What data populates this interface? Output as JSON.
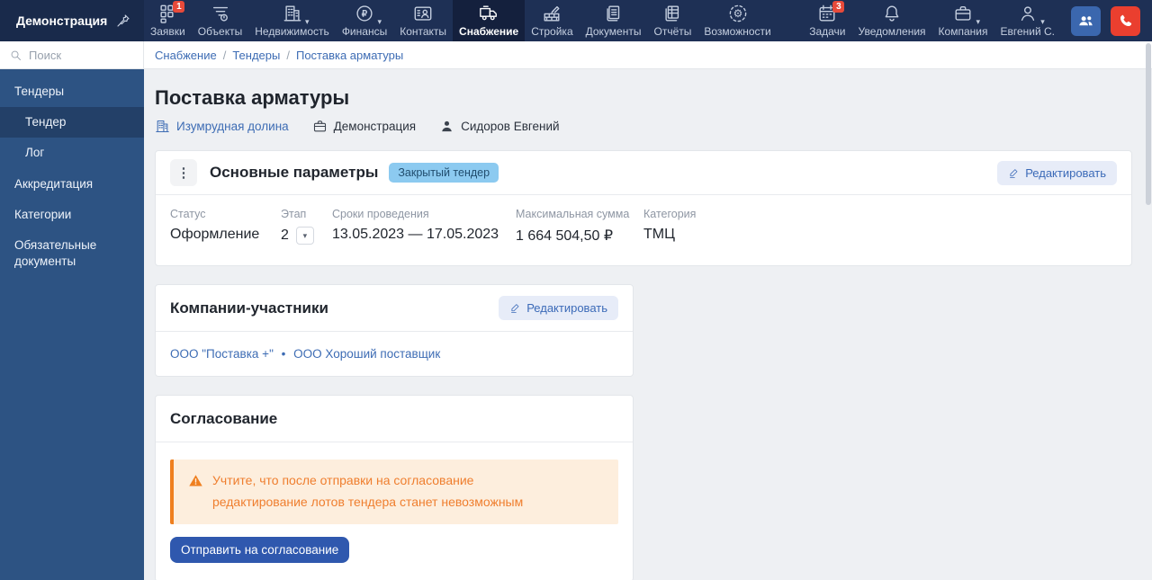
{
  "colors": {
    "topbar_bg": "#1e3055",
    "topbar_left_bg": "#192a4b",
    "topbar_active_bg": "#14203d",
    "badge_red": "#e84a3a",
    "sidebar_bg": "#2d5383",
    "sidebar_active_bg": "#234068",
    "link_blue": "#3d6cb4",
    "tag_blue_bg": "#8ccaf0",
    "tag_blue_text": "#214d6e",
    "edit_btn_bg": "#e7ecf8",
    "edit_btn_text": "#3b6ab8",
    "warning_bg": "#fdeedd",
    "warning_accent": "#ef7f1f",
    "warning_text": "#ef7e2e",
    "primary_btn_bg": "#2f58ae",
    "people_btn_blue": "#3b67ae",
    "call_btn_red": "#ea3f2f"
  },
  "topbar": {
    "workspace": "Демонстрация",
    "items": [
      {
        "label": "Заявки",
        "badge": "1"
      },
      {
        "label": "Объекты"
      },
      {
        "label": "Недвижимость"
      },
      {
        "label": "Финансы"
      },
      {
        "label": "Контакты"
      },
      {
        "label": "Снабжение"
      },
      {
        "label": "Стройка"
      },
      {
        "label": "Документы"
      },
      {
        "label": "Отчёты"
      },
      {
        "label": "Возможности"
      }
    ],
    "right_items": [
      {
        "label": "Задачи",
        "badge": "3"
      },
      {
        "label": "Уведомления"
      },
      {
        "label": "Компания"
      },
      {
        "label": "Евгений С."
      }
    ]
  },
  "sidebar": {
    "search_placeholder": "Поиск",
    "items": [
      {
        "label": "Тендеры"
      },
      {
        "label": "Тендер"
      },
      {
        "label": "Лог"
      },
      {
        "label": "Аккредитация"
      },
      {
        "label": "Категории"
      },
      {
        "label": "Обязательные документы"
      }
    ]
  },
  "breadcrumb": {
    "separator": "/",
    "items": [
      "Снабжение",
      "Тендеры",
      "Поставка арматуры"
    ]
  },
  "page": {
    "title": "Поставка арматуры",
    "meta": {
      "project": "Изумрудная долина",
      "company": "Демонстрация",
      "owner": "Сидоров Евгений"
    }
  },
  "cards": {
    "main_params": {
      "title": "Основные параметры",
      "badge": "Закрытый тендер",
      "edit_label": "Редактировать",
      "fields": [
        {
          "label": "Статус",
          "value": "Оформление"
        },
        {
          "label": "Этап",
          "value": "2"
        },
        {
          "label": "Сроки проведения",
          "value": "13.05.2023 — 17.05.2023"
        },
        {
          "label": "Максимальная сумма",
          "value": "1 664 504,50 ₽"
        },
        {
          "label": "Категория",
          "value": "ТМЦ"
        }
      ]
    },
    "participants": {
      "title": "Компании-участники",
      "edit_label": "Редактировать",
      "separator": "•",
      "companies": [
        "ООО \"Поставка +\"",
        "ООО Хороший поставщик"
      ]
    },
    "approval": {
      "title": "Согласование",
      "warning_line1": "Учтите, что после отправки на согласование",
      "warning_line2": "редактирование лотов тендера станет невозможным",
      "submit_label": "Отправить на согласование"
    }
  }
}
